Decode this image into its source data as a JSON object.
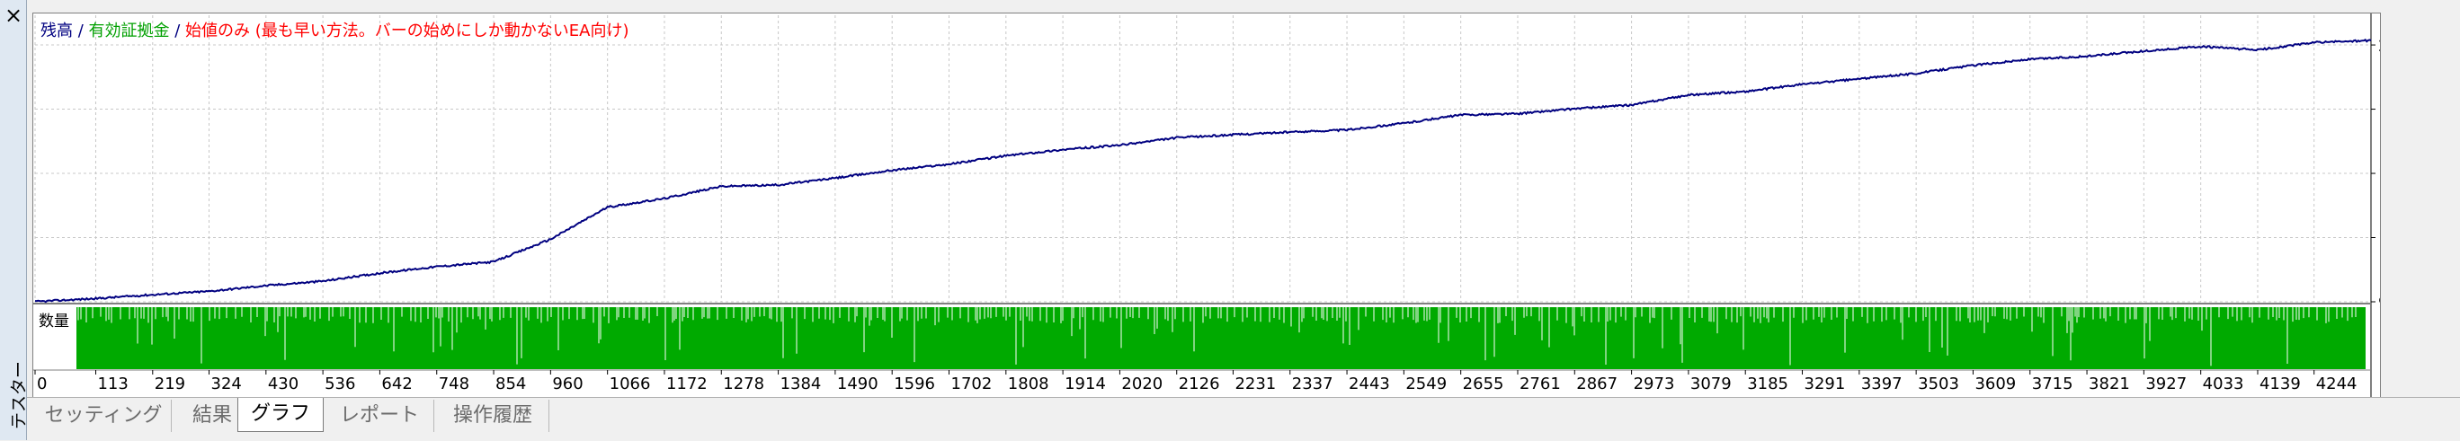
{
  "sidebar": {
    "close_glyph": "×",
    "title": "テスター"
  },
  "legend": {
    "balance": "残高",
    "sep1": " / ",
    "equity": "有効証拠金",
    "sep2": " / ",
    "note": "始値のみ (最も早い方法。バーの始めにしか動かないEA向け)"
  },
  "volume_label": "数量",
  "tabs": [
    {
      "label": "セッティング",
      "active": false
    },
    {
      "label": "結果",
      "active": false
    },
    {
      "label": "グラフ",
      "active": true
    },
    {
      "label": "レポート",
      "active": false
    },
    {
      "label": "操作履歴",
      "active": false
    }
  ],
  "colors": {
    "balance": "#000080",
    "equity": "#00a000",
    "note": "#ff0000",
    "volume": "#00aa00",
    "grid": "#c8c8c8"
  },
  "chart_data": {
    "type": "line",
    "series": [
      {
        "name": "残高",
        "x": [
          0,
          113,
          219,
          324,
          430,
          536,
          642,
          748,
          854,
          960,
          1066,
          1172,
          1278,
          1384,
          1490,
          1596,
          1702,
          1808,
          1914,
          2020,
          2126,
          2231,
          2337,
          2443,
          2549,
          2655,
          2761,
          2867,
          2973,
          3079,
          3185,
          3291,
          3397,
          3503,
          3609,
          3715,
          3821,
          3927,
          4033,
          4139,
          4244,
          4350
        ],
        "values": [
          930500,
          946000,
          965000,
          982000,
          1010000,
          1032000,
          1072000,
          1104000,
          1128000,
          1240000,
          1399000,
          1442000,
          1502000,
          1509000,
          1543000,
          1582000,
          1612000,
          1654000,
          1684000,
          1706000,
          1743000,
          1758000,
          1771000,
          1782000,
          1815000,
          1856000,
          1862000,
          1887000,
          1905000,
          1955000,
          1972000,
          2008000,
          2035000,
          2062000,
          2102000,
          2132000,
          2147000,
          2172000,
          2195000,
          2178000,
          2215000,
          2225000
        ]
      }
    ],
    "volume_series": {
      "name": "数量",
      "values": [
        1
      ]
    },
    "x_ticks": [
      0,
      113,
      219,
      324,
      430,
      536,
      642,
      748,
      854,
      960,
      1066,
      1172,
      1278,
      1384,
      1490,
      1596,
      1702,
      1808,
      1914,
      2020,
      2126,
      2231,
      2337,
      2443,
      2549,
      2655,
      2761,
      2867,
      2973,
      3079,
      3185,
      3291,
      3397,
      3503,
      3609,
      3715,
      3821,
      3927,
      4033,
      4139,
      4244
    ],
    "y_ticks": [
      929919,
      1248145,
      1566372,
      1884598,
      2202824
    ],
    "ylim": [
      929919,
      2350000
    ],
    "xlim": [
      0,
      4350
    ],
    "grid": true
  }
}
